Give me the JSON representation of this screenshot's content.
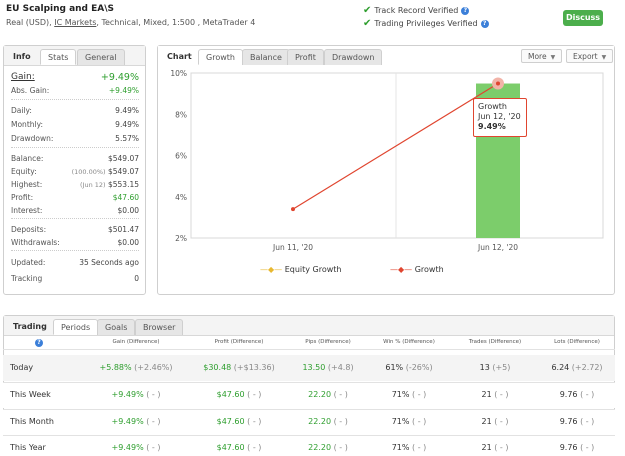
{
  "header": {
    "title": "EU Scalping and EA\\S",
    "sub_prefix": "Real (USD),",
    "broker": "IC Markets",
    "sub_suffix": ", Technical, Mixed, 1:500 , MetaTrader 4",
    "track_record": "Track Record Verified",
    "trading_priv": "Trading Privileges Verified",
    "discuss": "Discuss"
  },
  "info": {
    "tabs": [
      "Info",
      "Stats",
      "General"
    ],
    "gain_label": "Gain:",
    "gain_value": "+9.49%",
    "absgain_label": "Abs. Gain:",
    "absgain_value": "+9.49%",
    "daily_label": "Daily:",
    "daily_value": "9.49%",
    "monthly_label": "Monthly:",
    "monthly_value": "9.49%",
    "drawdown_label": "Drawdown:",
    "drawdown_value": "5.57%",
    "balance_label": "Balance:",
    "balance_value": "$549.07",
    "equity_label": "Equity:",
    "equity_note": "(100.00%)",
    "equity_value": "$549.07",
    "highest_label": "Highest:",
    "highest_note": "(Jun 12)",
    "highest_value": "$553.15",
    "profit_label": "Profit:",
    "profit_value": "$47.60",
    "interest_label": "Interest:",
    "interest_value": "$0.00",
    "deposits_label": "Deposits:",
    "deposits_value": "$501.47",
    "withdrawals_label": "Withdrawals:",
    "withdrawals_value": "$0.00",
    "updated_label": "Updated:",
    "updated_value": "35 Seconds ago",
    "tracking_label": "Tracking",
    "tracking_value": "0"
  },
  "chart_panel": {
    "tabs": [
      "Chart",
      "Growth",
      "Balance",
      "Profit",
      "Drawdown"
    ],
    "more": "More",
    "export": "Export",
    "tooltip": {
      "series": "Growth",
      "date": "Jun 12, '20",
      "value": "9.49%"
    }
  },
  "chart_data": {
    "type": "line",
    "x": [
      "Jun 11, '20",
      "Jun 12, '20"
    ],
    "yticks": [
      "2%",
      "4%",
      "6%",
      "8%",
      "10%"
    ],
    "ylim": [
      2,
      10
    ],
    "series": [
      {
        "name": "Equity Growth",
        "type": "bar",
        "values": [
          null,
          9.49
        ],
        "color": "#7ccd6b"
      },
      {
        "name": "Growth",
        "type": "line",
        "values": [
          3.4,
          9.49
        ],
        "color": "#e0452f"
      }
    ],
    "legend_position": "bottom"
  },
  "trading": {
    "tabs": [
      "Trading",
      "Periods",
      "Goals",
      "Browser"
    ],
    "columns": [
      "Gain (Difference)",
      "Profit (Difference)",
      "Pips (Difference)",
      "Win % (Difference)",
      "Trades (Difference)",
      "Lots (Difference)"
    ],
    "rows": [
      {
        "label": "Today",
        "gain": "+5.88%",
        "gain_d": "(+2.46%)",
        "profit": "$30.48",
        "profit_d": "(+$13.36)",
        "pips": "13.50",
        "pips_d": "(+4.8)",
        "win": "61%",
        "win_d": "(-26%)",
        "trades": "13",
        "trades_d": "(+5)",
        "lots": "6.24",
        "lots_d": "(+2.72)"
      },
      {
        "label": "This Week",
        "gain": "+9.49%",
        "gain_d": "( - )",
        "profit": "$47.60",
        "profit_d": "( - )",
        "pips": "22.20",
        "pips_d": "( - )",
        "win": "71%",
        "win_d": "( - )",
        "trades": "21",
        "trades_d": "( - )",
        "lots": "9.76",
        "lots_d": "( - )"
      },
      {
        "label": "This Month",
        "gain": "+9.49%",
        "gain_d": "( - )",
        "profit": "$47.60",
        "profit_d": "( - )",
        "pips": "22.20",
        "pips_d": "( - )",
        "win": "71%",
        "win_d": "( - )",
        "trades": "21",
        "trades_d": "( - )",
        "lots": "9.76",
        "lots_d": "( - )"
      },
      {
        "label": "This Year",
        "gain": "+9.49%",
        "gain_d": "( - )",
        "profit": "$47.60",
        "profit_d": "( - )",
        "pips": "22.20",
        "pips_d": "( - )",
        "win": "71%",
        "win_d": "( - )",
        "trades": "21",
        "trades_d": "( - )",
        "lots": "9.76",
        "lots_d": "( - )"
      }
    ]
  }
}
